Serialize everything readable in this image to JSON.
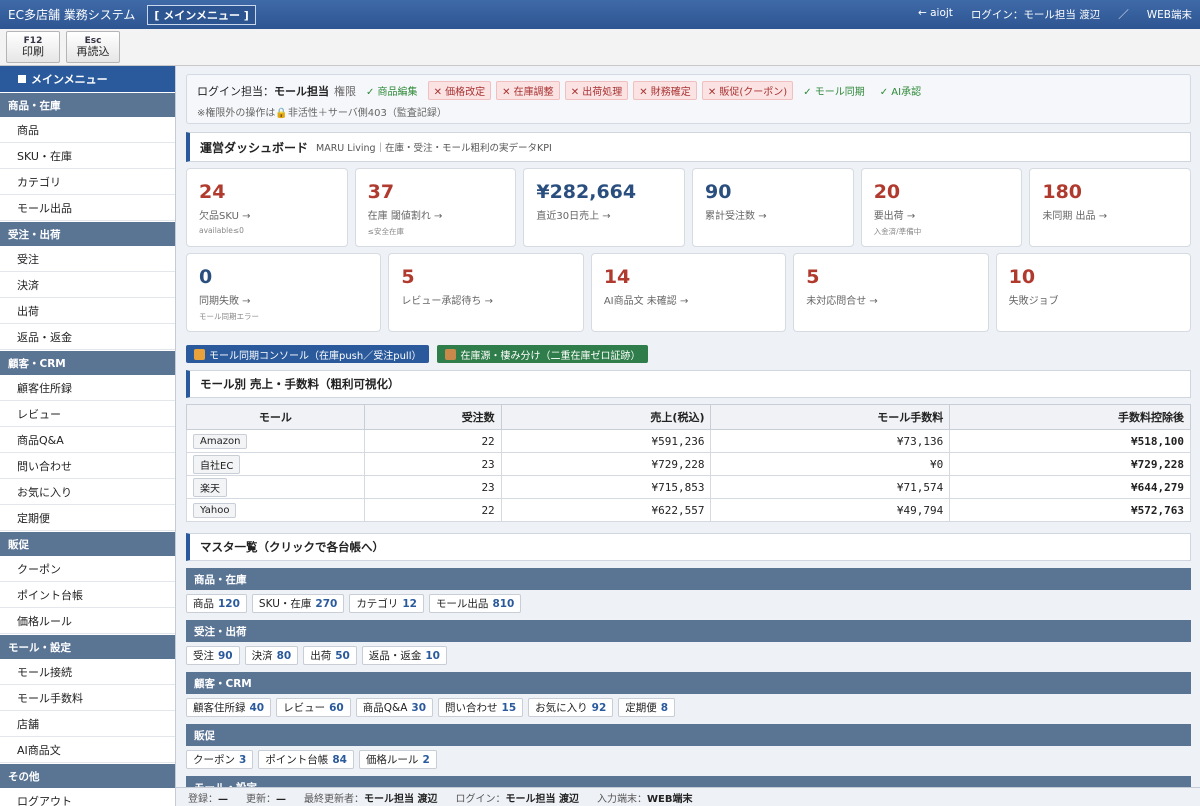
{
  "titlebar": {
    "app": "EC多店舗 業務システム",
    "menu": "[ メインメニュー ]",
    "back": "← aiojt",
    "login": "ログイン：モール担当 渡辺",
    "sep": "／",
    "terminal": "WEB端末"
  },
  "toolbar": {
    "print_key": "F12",
    "print_label": "印刷",
    "reload_key": "Esc",
    "reload_label": "再読込"
  },
  "sidebar": {
    "main": "メインメニュー",
    "sections": [
      {
        "title": "商品・在庫",
        "items": [
          "商品",
          "SKU・在庫",
          "カテゴリ",
          "モール出品"
        ]
      },
      {
        "title": "受注・出荷",
        "items": [
          "受注",
          "決済",
          "出荷",
          "返品・返金"
        ]
      },
      {
        "title": "顧客・CRM",
        "items": [
          "顧客住所録",
          "レビュー",
          "商品Q&A",
          "問い合わせ",
          "お気に入り",
          "定期便"
        ]
      },
      {
        "title": "販促",
        "items": [
          "クーポン",
          "ポイント台帳",
          "価格ルール"
        ]
      },
      {
        "title": "モール・設定",
        "items": [
          "モール接続",
          "モール手数料",
          "店舗",
          "AI商品文"
        ]
      },
      {
        "title": "その他",
        "items": [
          "ログアウト"
        ]
      }
    ]
  },
  "permissions": {
    "label": "ログイン担当：",
    "role": "モール担当",
    "auth": "権限",
    "chips": [
      {
        "text": "✓ 商品編集",
        "ok": true
      },
      {
        "text": "✕ 価格改定",
        "ok": false
      },
      {
        "text": "✕ 在庫調整",
        "ok": false
      },
      {
        "text": "✕ 出荷処理",
        "ok": false
      },
      {
        "text": "✕ 財務確定",
        "ok": false
      },
      {
        "text": "✕ 販促(クーポン)",
        "ok": false
      },
      {
        "text": "✓ モール同期",
        "ok": true
      },
      {
        "text": "✓ AI承認",
        "ok": true
      }
    ],
    "note": "※権限外の操作は🔒非活性＋サーバ側403（監査記録）"
  },
  "dashboard": {
    "title": "運営ダッシュボード",
    "sub": "MARU Living｜在庫・受注・モール粗利の実データKPI"
  },
  "kpi_row1": [
    {
      "value": "24",
      "label": "欠品SKU →",
      "sub": "available≤0",
      "color": "red"
    },
    {
      "value": "37",
      "label": "在庫 閾値割れ →",
      "sub": "≤安全在庫",
      "color": "red"
    },
    {
      "value": "¥282,664",
      "label": "直近30日売上 →",
      "sub": "",
      "color": "blue"
    },
    {
      "value": "90",
      "label": "累計受注数 →",
      "sub": "",
      "color": "blue"
    },
    {
      "value": "20",
      "label": "要出荷 →",
      "sub": "入金済/準備中",
      "color": "red"
    },
    {
      "value": "180",
      "label": "未同期 出品 →",
      "sub": "",
      "color": "red"
    }
  ],
  "kpi_row2": [
    {
      "value": "0",
      "label": "同期失敗 →",
      "sub": "モール同期エラー",
      "color": "blue"
    },
    {
      "value": "5",
      "label": "レビュー承認待ち →",
      "sub": "",
      "color": "red"
    },
    {
      "value": "14",
      "label": "AI商品文 未確認 →",
      "sub": "",
      "color": "red"
    },
    {
      "value": "5",
      "label": "未対応問合せ →",
      "sub": "",
      "color": "red"
    },
    {
      "value": "10",
      "label": "失敗ジョブ",
      "sub": "",
      "color": "red"
    }
  ],
  "actions": {
    "sync": "モール同期コンソール（在庫push／受注pull）",
    "stock": "在庫源・棲み分け（二重在庫ゼロ証跡）"
  },
  "mall_table": {
    "title": "モール別 売上・手数料（粗利可視化）",
    "headers": [
      "モール",
      "受注数",
      "売上(税込)",
      "モール手数料",
      "手数料控除後"
    ],
    "rows": [
      [
        "Amazon",
        "22",
        "¥591,236",
        "¥73,136",
        "¥518,100"
      ],
      [
        "自社EC",
        "23",
        "¥729,228",
        "¥0",
        "¥729,228"
      ],
      [
        "楽天",
        "23",
        "¥715,853",
        "¥71,574",
        "¥644,279"
      ],
      [
        "Yahoo",
        "22",
        "¥622,557",
        "¥49,794",
        "¥572,763"
      ]
    ]
  },
  "master": {
    "title": "マスタ一覧（クリックで各台帳へ）",
    "groups": [
      {
        "title": "商品・在庫",
        "items": [
          {
            "label": "商品",
            "count": "120"
          },
          {
            "label": "SKU・在庫",
            "count": "270"
          },
          {
            "label": "カテゴリ",
            "count": "12"
          },
          {
            "label": "モール出品",
            "count": "810"
          }
        ]
      },
      {
        "title": "受注・出荷",
        "items": [
          {
            "label": "受注",
            "count": "90"
          },
          {
            "label": "決済",
            "count": "80"
          },
          {
            "label": "出荷",
            "count": "50"
          },
          {
            "label": "返品・返金",
            "count": "10"
          }
        ]
      },
      {
        "title": "顧客・CRM",
        "items": [
          {
            "label": "顧客住所録",
            "count": "40"
          },
          {
            "label": "レビュー",
            "count": "60"
          },
          {
            "label": "商品Q&A",
            "count": "30"
          },
          {
            "label": "問い合わせ",
            "count": "15"
          },
          {
            "label": "お気に入り",
            "count": "92"
          },
          {
            "label": "定期便",
            "count": "8"
          }
        ]
      },
      {
        "title": "販促",
        "items": [
          {
            "label": "クーポン",
            "count": "3"
          },
          {
            "label": "ポイント台帳",
            "count": "84"
          },
          {
            "label": "価格ルール",
            "count": "2"
          }
        ]
      },
      {
        "title": "モール・設定",
        "items": []
      }
    ]
  },
  "status": {
    "reg_l": "登録：",
    "reg_v": "—",
    "upd_l": "更新：",
    "upd_v": "—",
    "last_l": "最終更新者：",
    "last_v": "モール担当 渡辺",
    "login_l": "ログイン：",
    "login_v": "モール担当 渡辺",
    "term_l": "入力端末：",
    "term_v": "WEB端末"
  },
  "colors": {
    "header": "#2d5592",
    "section": "#5a7494",
    "alert": "#b03a2e",
    "value": "#2a4f7f"
  }
}
